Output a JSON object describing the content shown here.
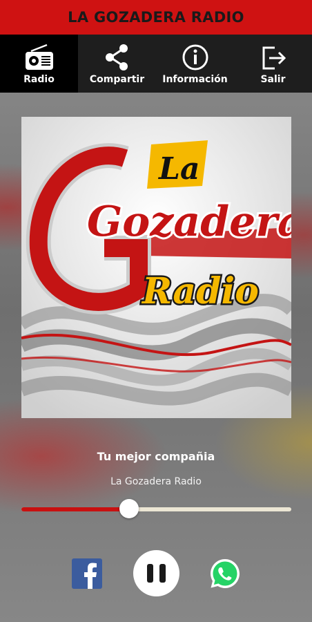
{
  "app": {
    "title": "LA GOZADERA RADIO"
  },
  "toolbar": {
    "items": [
      {
        "label": "Radio",
        "icon": "radio-icon",
        "active": true
      },
      {
        "label": "Compartir",
        "icon": "share-icon",
        "active": false
      },
      {
        "label": "Información",
        "icon": "info-icon",
        "active": false
      },
      {
        "label": "Salir",
        "icon": "exit-icon",
        "active": false
      }
    ]
  },
  "artwork": {
    "logo_top": "La",
    "logo_main": "Gozadera",
    "logo_sub": "Radio"
  },
  "player": {
    "tagline": "Tu mejor compañia",
    "station": "La Gozadera Radio",
    "volume": 0.4,
    "state": "playing"
  },
  "share_buttons": [
    {
      "name": "facebook",
      "icon": "facebook-icon"
    },
    {
      "name": "whatsapp",
      "icon": "whatsapp-icon"
    }
  ],
  "colors": {
    "brand_red": "#cf1212",
    "toolbar_bg": "#1e1e1e",
    "slider_fill": "#c81010",
    "slider_track": "#ece6d4",
    "facebook_blue": "#3b5c9e",
    "whatsapp_green": "#25d366"
  }
}
